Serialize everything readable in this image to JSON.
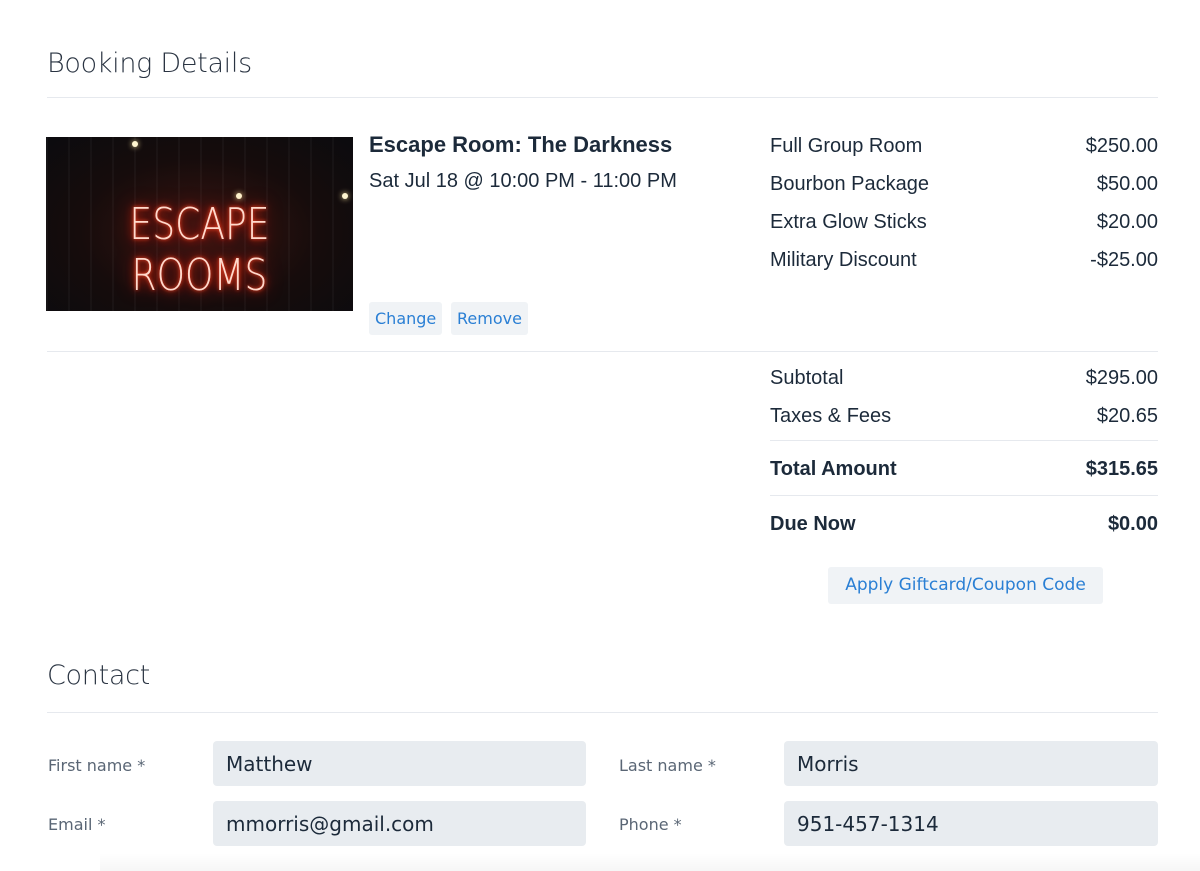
{
  "booking": {
    "title": "Booking Details",
    "image_text": "ESCAPE ROOMS",
    "event_title": "Escape Room: The Darkness",
    "event_time": "Sat Jul 18 @ 10:00 PM - 11:00 PM",
    "change_label": "Change",
    "remove_label": "Remove",
    "items": [
      {
        "label": "Full Group Room",
        "amount": "$250.00"
      },
      {
        "label": "Bourbon Package",
        "amount": "$50.00"
      },
      {
        "label": "Extra Glow Sticks",
        "amount": "$20.00"
      },
      {
        "label": "Military Discount",
        "amount": "-$25.00"
      }
    ],
    "subtotal": {
      "label": "Subtotal",
      "amount": "$295.00"
    },
    "taxes": {
      "label": "Taxes & Fees",
      "amount": "$20.65"
    },
    "total": {
      "label": "Total Amount",
      "amount": "$315.65"
    },
    "due": {
      "label": "Due Now",
      "amount": "$0.00"
    },
    "coupon_label": "Apply Giftcard/Coupon Code"
  },
  "contact": {
    "title": "Contact",
    "first_name": {
      "label": "First name *",
      "value": "Matthew"
    },
    "last_name": {
      "label": "Last name *",
      "value": "Morris"
    },
    "email": {
      "label": "Email *",
      "value": "mmorris@gmail.com"
    },
    "phone": {
      "label": "Phone *",
      "value": "951-457-1314"
    }
  },
  "colors": {
    "accent": "#2a7fd4",
    "text": "#1c2a3a",
    "input_bg": "#e8ecf0",
    "button_bg": "#f0f3f6"
  }
}
